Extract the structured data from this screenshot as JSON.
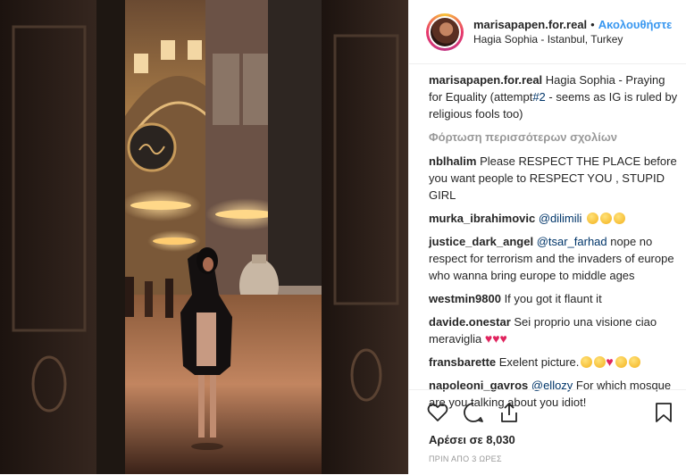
{
  "header": {
    "username": "marisapapen.for.real",
    "separator": "•",
    "follow_label": "Ακολουθήστε",
    "location": "Hagia Sophia - Istanbul, Turkey"
  },
  "caption": {
    "user": "marisapapen.for.real",
    "text_before": "Hagia Sophia - Praying for Equality (attempt",
    "hashtag": "#2",
    "text_after": " - seems as IG is ruled by religious fools too)"
  },
  "load_more": "Φόρτωση περισσότερων σχολίων",
  "comments": [
    {
      "user": "nblhalim",
      "text": "Please RESPECT THE PLACE before you want people to RESPECT YOU , STUPID GIRL"
    },
    {
      "user": "murka_ibrahimovic",
      "mention": "@dilimili",
      "text": ""
    },
    {
      "user": "justice_dark_angel",
      "mention": "@tsar_farhad",
      "text": " nope no respect for terrorism and the invaders of europe who wanna bring europe to middle ages"
    },
    {
      "user": "westmin9800",
      "text": "If you got it flaunt it"
    },
    {
      "user": "davide.onestar",
      "text": "Sei proprio una visione ciao meraviglia"
    },
    {
      "user": "fransbarette",
      "text": "Exelent picture."
    },
    {
      "user": "napoleoni_gavros",
      "mention": "@ellozy",
      "text": " For which mosque are you talking about you idiot!"
    }
  ],
  "likes": "Αρέσει σε 8,030",
  "timestamp": "ΠΡΙΝ ΑΠΟ 3 ΩΡΕΣ",
  "icons": [
    "heart-icon",
    "comment-icon",
    "share-icon",
    "bookmark-icon"
  ],
  "colors": {
    "link": "#3897f0",
    "mention": "#003569",
    "muted": "#999999"
  }
}
